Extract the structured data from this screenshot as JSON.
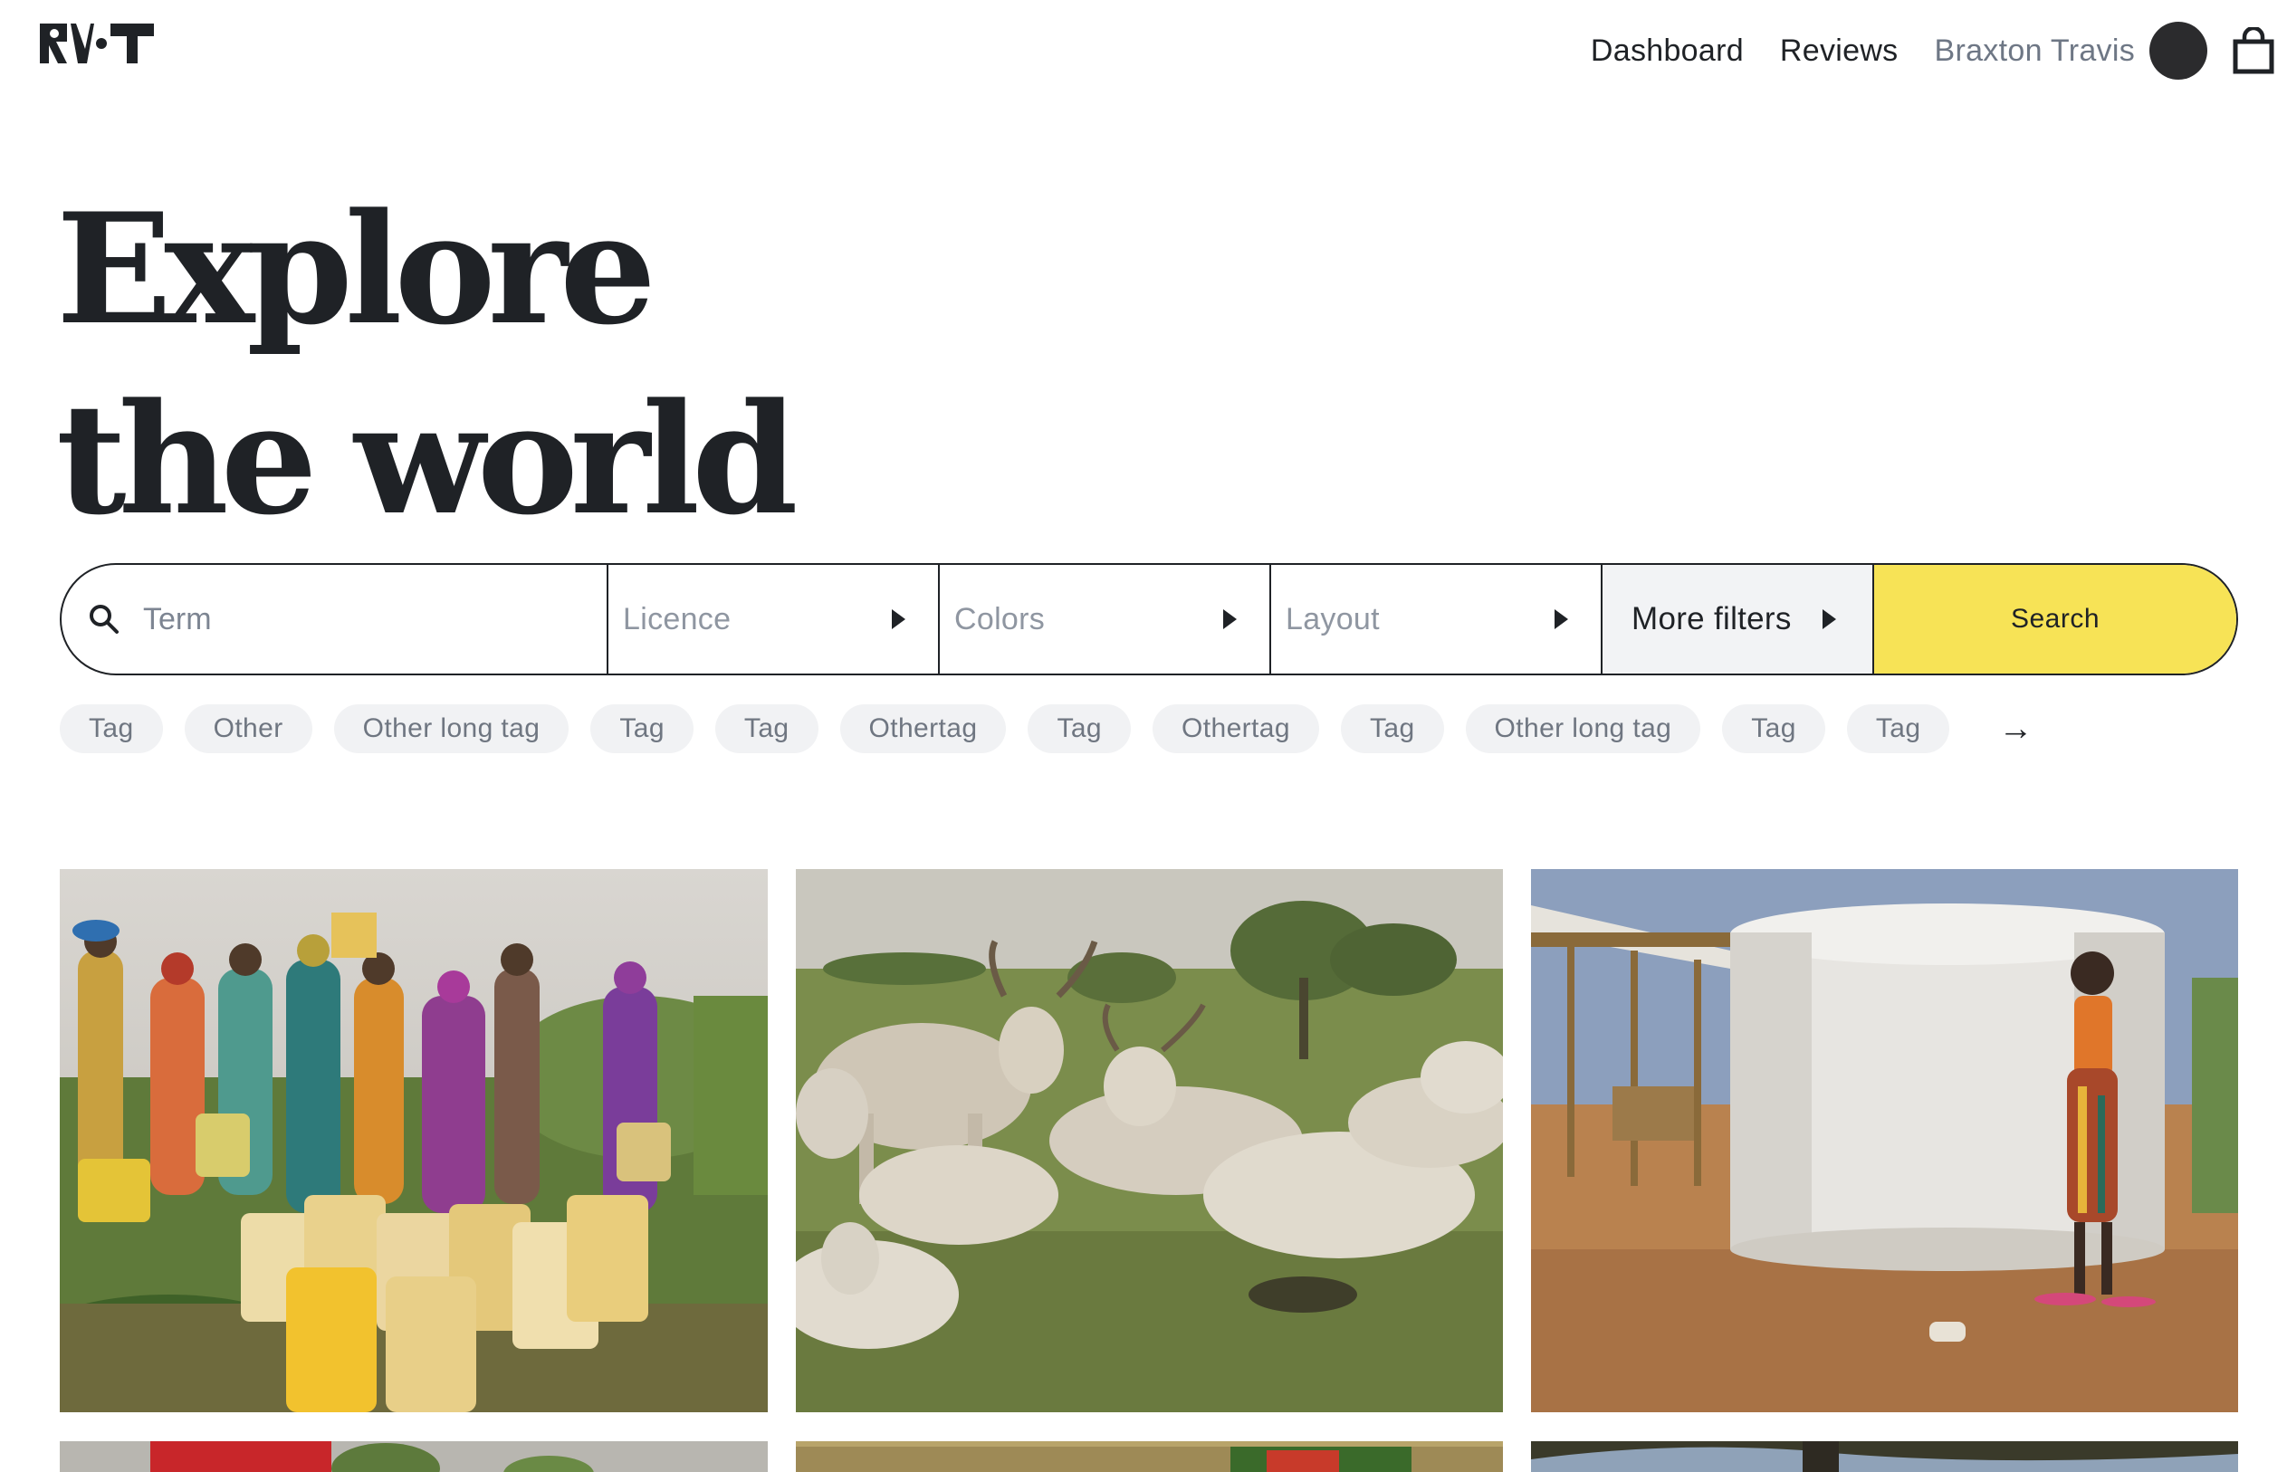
{
  "header": {
    "logo_alt": "RIT",
    "nav": {
      "dashboard": "Dashboard",
      "reviews": "Reviews",
      "user_name": "Braxton Travis"
    }
  },
  "hero": {
    "line1": "Explore",
    "line2": "the world"
  },
  "search": {
    "term_placeholder": "Term",
    "licence": "Licence",
    "colors": "Colors",
    "layout": "Layout",
    "more_filters": "More filters",
    "button": "Search"
  },
  "tags": [
    "Tag",
    "Other",
    "Other long tag",
    "Tag",
    "Tag",
    "Othertag",
    "Tag",
    "Othertag",
    "Tag",
    "Other long tag",
    "Tag",
    "Tag"
  ],
  "tags_more_icon": "arrow-right-icon",
  "photos": [
    {
      "name": "photo-women-water-jerrycans"
    },
    {
      "name": "photo-cattle-resting"
    },
    {
      "name": "photo-girl-water-tank"
    },
    {
      "name": "photo-partial-red"
    },
    {
      "name": "photo-partial-fence"
    },
    {
      "name": "photo-partial-tree"
    }
  ],
  "colors": {
    "accent": "#f7e356",
    "text": "#1f2226",
    "muted": "#6e7785",
    "tag_bg": "#f1f2f4"
  }
}
